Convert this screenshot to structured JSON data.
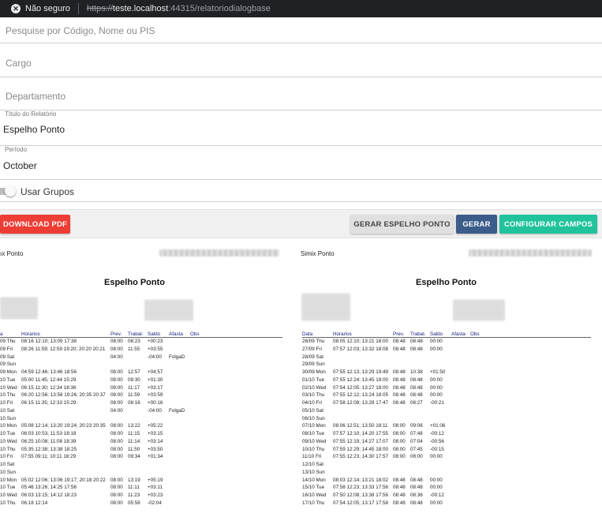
{
  "browser": {
    "security_label": "Não seguro",
    "protocol": "https://",
    "host": "teste.localhost",
    "port": ":44315",
    "path": "/relatoriodialogbase"
  },
  "filters": {
    "search_placeholder": "Pesquise por Código, Nome ou PIS",
    "cargo_placeholder": "Cargo",
    "departamento_placeholder": "Departamento",
    "titulo_label": "Título do Relatório",
    "titulo_value": "Espelho Ponto",
    "periodo_label": "Período",
    "periodo_value": "October",
    "usar_grupos_label": "Usar Grupos"
  },
  "toolbar": {
    "download_pdf": "DOWNLOAD PDF",
    "gerar_espelho": "GERAR ESPELHO PONTO",
    "gerar": "GERAR",
    "configurar": "CONFIGURAR CAMPOS"
  },
  "reports": [
    {
      "company_label": "ıx Ponto",
      "title": "Espelho Ponto",
      "columns": [
        "a",
        "Horarios",
        "Prev.",
        "Trabal.",
        "Saldo",
        "Afasta",
        "Obs"
      ],
      "rows": [
        [
          "09 Thu",
          "08:16 12:10; 13:09 17:38",
          "08:00",
          "08:23",
          "+00:23",
          "",
          ""
        ],
        [
          "09 Fri",
          "08:26 11:59; 12:59 19:20; 20:20 20:21",
          "08:00",
          "11:55",
          "+03:55",
          "",
          ""
        ],
        [
          "09 Sat",
          "",
          "04:00",
          "",
          "-04:00",
          "FolgaD",
          ""
        ],
        [
          "09 Sun",
          "",
          "",
          "",
          "",
          "",
          ""
        ],
        [
          "09 Mon",
          "04:59 12:46; 13:46 18:56",
          "08:00",
          "12:57",
          "+04:57",
          "",
          ""
        ],
        [
          "10 Tue",
          "05:00 11:45; 12:44 15:29",
          "08:00",
          "09:30",
          "+01:30",
          "",
          ""
        ],
        [
          "10 Wed",
          "06:15 11:30; 12:34 18:36",
          "08:00",
          "11:17",
          "+03:17",
          "",
          ""
        ],
        [
          "10 Thu",
          "06:20 12:56; 13:56 19:26; 20:35 20:37",
          "08:00",
          "11:59",
          "+03:59",
          "",
          ""
        ],
        [
          "10 Fri",
          "06:15 11:35; 12:33 15:29",
          "08:00",
          "08:16",
          "+00:16",
          "",
          ""
        ],
        [
          "10 Sat",
          "",
          "04:00",
          "",
          "-04:00",
          "FolgaD",
          ""
        ],
        [
          "10 Sun",
          "",
          "",
          "",
          "",
          "",
          ""
        ],
        [
          "10 Mon",
          "05:08 12:14; 13:20 19:24; 20:23 20:35",
          "08:00",
          "13:22",
          "+05:22",
          "",
          ""
        ],
        [
          "10 Tue",
          "06:03 10:53; 11:53 18:18",
          "08:00",
          "11:15",
          "+03:15",
          "",
          ""
        ],
        [
          "10 Wed",
          "06:25 10:08; 11:08 18:39",
          "08:00",
          "11:14",
          "+03:14",
          "",
          ""
        ],
        [
          "10 Thu",
          "05:35 12:38; 13:38 18:25",
          "08:00",
          "11:50",
          "+03:50",
          "",
          ""
        ],
        [
          "10 Fri",
          "07:55 09:11; 10:11 18:29",
          "08:00",
          "09:34",
          "+01:34",
          "",
          ""
        ],
        [
          "10 Sat",
          "",
          "",
          "",
          "",
          "",
          ""
        ],
        [
          "10 Sun",
          "",
          "",
          "",
          "",
          "",
          ""
        ],
        [
          "10 Mon",
          "05:02 12:06; 13:06 19:17; 20:18 20:22",
          "08:00",
          "13:19",
          "+05:19",
          "",
          ""
        ],
        [
          "10 Tue",
          "05:46 13:26; 14:25 17:56",
          "08:00",
          "11:11",
          "+03:11",
          "",
          ""
        ],
        [
          "10 Wed",
          "06:03 13:15; 14:12 18:23",
          "08:00",
          "11:23",
          "+03:23",
          "",
          ""
        ],
        [
          "10 Thu",
          "06:18 12:14",
          "08:00",
          "05:56",
          "-02:04",
          "",
          ""
        ]
      ]
    },
    {
      "company_label": "Simix Ponto",
      "title": "Espelho Ponto",
      "columns": [
        "Data",
        "Horarios",
        "Prev.",
        "Trabal.",
        "Saldo",
        "Afasta",
        "Obs"
      ],
      "rows": [
        [
          "26/09 Thu",
          "08:05 12:10; 13:21 18:00",
          "08:48",
          "08:48",
          "00:00",
          "",
          ""
        ],
        [
          "27/09 Fri",
          "07:57 12:03; 13:32 18:08",
          "08:48",
          "08:48",
          "00:00",
          "",
          ""
        ],
        [
          "28/09 Sat",
          "",
          "",
          "",
          "",
          "",
          ""
        ],
        [
          "29/09 Sun",
          "",
          "",
          "",
          "",
          "",
          ""
        ],
        [
          "30/09 Mon",
          "07:55 12:13; 13:29 19:49",
          "08:48",
          "10:38",
          "+01:50",
          "",
          ""
        ],
        [
          "01/10 Tue",
          "07:55 12:24; 13:45 18:00",
          "08:48",
          "08:48",
          "00:00",
          "",
          ""
        ],
        [
          "02/10 Wed",
          "07:54 12:05; 13:27 18:00",
          "08:48",
          "08:48",
          "00:00",
          "",
          ""
        ],
        [
          "03/10 Thu",
          "07:55 12:12; 13:24 18:05",
          "08:48",
          "08:48",
          "00:00",
          "",
          ""
        ],
        [
          "04/10 Fri",
          "07:58 12:08; 13:28 17:47",
          "08:48",
          "08:27",
          "-00:21",
          "",
          ""
        ],
        [
          "05/10 Sat",
          "",
          "",
          "",
          "",
          "",
          ""
        ],
        [
          "06/10 Sun",
          "",
          "",
          "",
          "",
          "",
          ""
        ],
        [
          "07/10 Mon",
          "08:06 12:51; 13:50 18:11",
          "08:00",
          "09:06",
          "+01:06",
          "",
          ""
        ],
        [
          "08/10 Tue",
          "07:57 12:10; 14:20 17:55",
          "08:00",
          "07:48",
          "-00:12",
          "",
          ""
        ],
        [
          "09/10 Wed",
          "07:55 12:19; 14:27 17:07",
          "08:00",
          "07:04",
          "-00:56",
          "",
          ""
        ],
        [
          "10/10 Thu",
          "07:59 12:29; 14:45 18:00",
          "08:00",
          "07:45",
          "-00:15",
          "",
          ""
        ],
        [
          "11/10 Fri",
          "07:55 12:23; 14:30 17:57",
          "08:00",
          "08:00",
          "00:00",
          "",
          ""
        ],
        [
          "12/10 Sat",
          "",
          "",
          "",
          "",
          "",
          ""
        ],
        [
          "13/10 Sun",
          "",
          "",
          "",
          "",
          "",
          ""
        ],
        [
          "14/10 Mon",
          "08:03 12:14; 13:21 18:02",
          "08:48",
          "08:48",
          "00:00",
          "",
          ""
        ],
        [
          "15/10 Tue",
          "07:58 12:23; 13:33 17:56",
          "08:48",
          "08:48",
          "00:00",
          "",
          ""
        ],
        [
          "16/10 Wed",
          "07:50 12:08; 13:38 17:56",
          "08:48",
          "08:36",
          "-00:12",
          "",
          ""
        ],
        [
          "17/10 Thu",
          "07:54 12:05; 13:17 17:58",
          "08:48",
          "08:48",
          "00:00",
          "",
          ""
        ]
      ]
    }
  ]
}
